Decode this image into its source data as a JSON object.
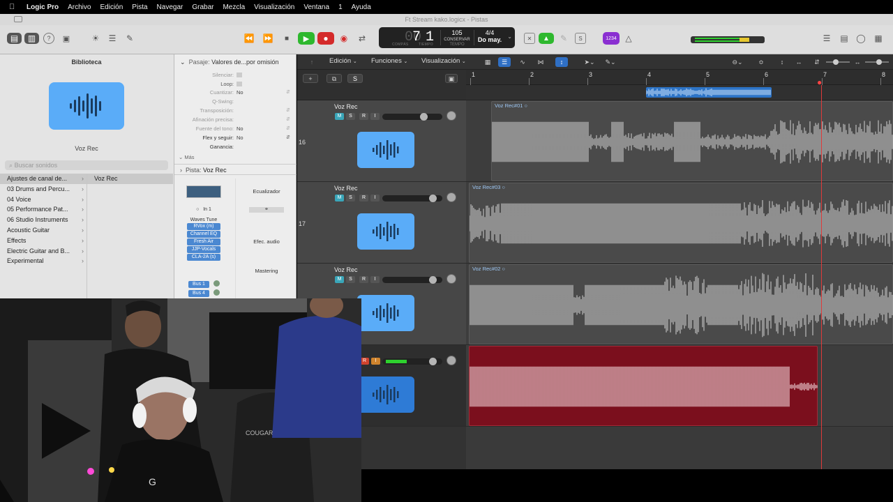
{
  "menubar": {
    "apple": "",
    "items": [
      "Logic Pro",
      "Archivo",
      "Edición",
      "Pista",
      "Navegar",
      "Grabar",
      "Mezcla",
      "Visualización",
      "Ventana",
      "1",
      "Ayuda"
    ]
  },
  "window": {
    "title": "Ft Stream kako.logicx - Pistas"
  },
  "lcd": {
    "bar": "7",
    "beat": "1",
    "cap_compas": "COMPÁS",
    "cap_tiempo": "TIEMPO",
    "tempo": "105",
    "tempo_mode": "CONSERVAR",
    "tempo_cap": "TEMPO",
    "signature": "4/4",
    "key": "Do may."
  },
  "count_in": "1234",
  "library": {
    "title": "Biblioteca",
    "preset_name": "Voz Rec",
    "search_placeholder": "Buscar sonidos",
    "categories": [
      "Ajustes de canal de...",
      "03 Drums and Percu...",
      "04 Voice",
      "05 Performance Pat...",
      "06 Studio Instruments",
      "Acoustic Guitar",
      "Effects",
      "Electric Guitar and B...",
      "Experimental"
    ],
    "selected_patch": "Voz Rec"
  },
  "inspector": {
    "region_header_label": "Pasaje:",
    "region_header_value": "Valores de...por omisión",
    "rows": [
      {
        "label": "Silenciar:",
        "value": ""
      },
      {
        "label": "Loop:",
        "value": ""
      },
      {
        "label": "Cuantizar:",
        "value": "No"
      },
      {
        "label": "Q-Swing:",
        "value": ""
      },
      {
        "label": "Transposición:",
        "value": ""
      },
      {
        "label": "Afinación precisa:",
        "value": ""
      },
      {
        "label": "Fuente del tono:",
        "value": "No"
      },
      {
        "label": "Flex y seguir:",
        "value": "No"
      },
      {
        "label": "Ganancia:",
        "value": ""
      }
    ],
    "more": "Más",
    "track_header_label": "Pista:",
    "track_header_value": "Voz Rec",
    "strip1": {
      "input": "In 1",
      "plugins": [
        "RVox (m)",
        "Channel EQ",
        "Fresh Air",
        "JJP-Vocals",
        "CLA-2A (s)"
      ],
      "plugins_header": "Waves Tune",
      "sends": [
        "Bus 1",
        "Bus 4"
      ]
    },
    "strip2": {
      "eq_label": "Ecualizador",
      "fx_label": "Efec. audio",
      "mastering_label": "Mastering"
    }
  },
  "tracks_toolbar": {
    "menus": [
      "Edición",
      "Funciones",
      "Visualización"
    ]
  },
  "track_header_buttons": {
    "add": "+",
    "dup": "⧉",
    "solo": "S"
  },
  "ruler": {
    "bars": [
      "1",
      "2",
      "3",
      "4",
      "5",
      "6",
      "7",
      "8"
    ]
  },
  "tracks": [
    {
      "number": "16",
      "name": "Voz Rec",
      "m": "M",
      "s": "S",
      "r": "R",
      "i": "I",
      "region": "Voz Rec#01"
    },
    {
      "number": "17",
      "name": "Voz Rec",
      "m": "M",
      "s": "S",
      "r": "R",
      "i": "I",
      "region": "Voz Rec#03"
    },
    {
      "number": "",
      "name": "Voz Rec",
      "m": "M",
      "s": "S",
      "r": "R",
      "i": "I",
      "region": "Voz Rec#02"
    },
    {
      "number": "",
      "name": "",
      "m": "",
      "s": "",
      "r": "R",
      "i": "I",
      "region": ""
    }
  ],
  "webcam": {
    "shirt_text": "COUGAR",
    "brand": "G"
  },
  "colors": {
    "accent_blue": "#5aacf8",
    "record_red": "#7b0f1d",
    "play_green": "#2eb82e",
    "playhead": "#e03a3a",
    "region_label": "#9ec8f5"
  }
}
